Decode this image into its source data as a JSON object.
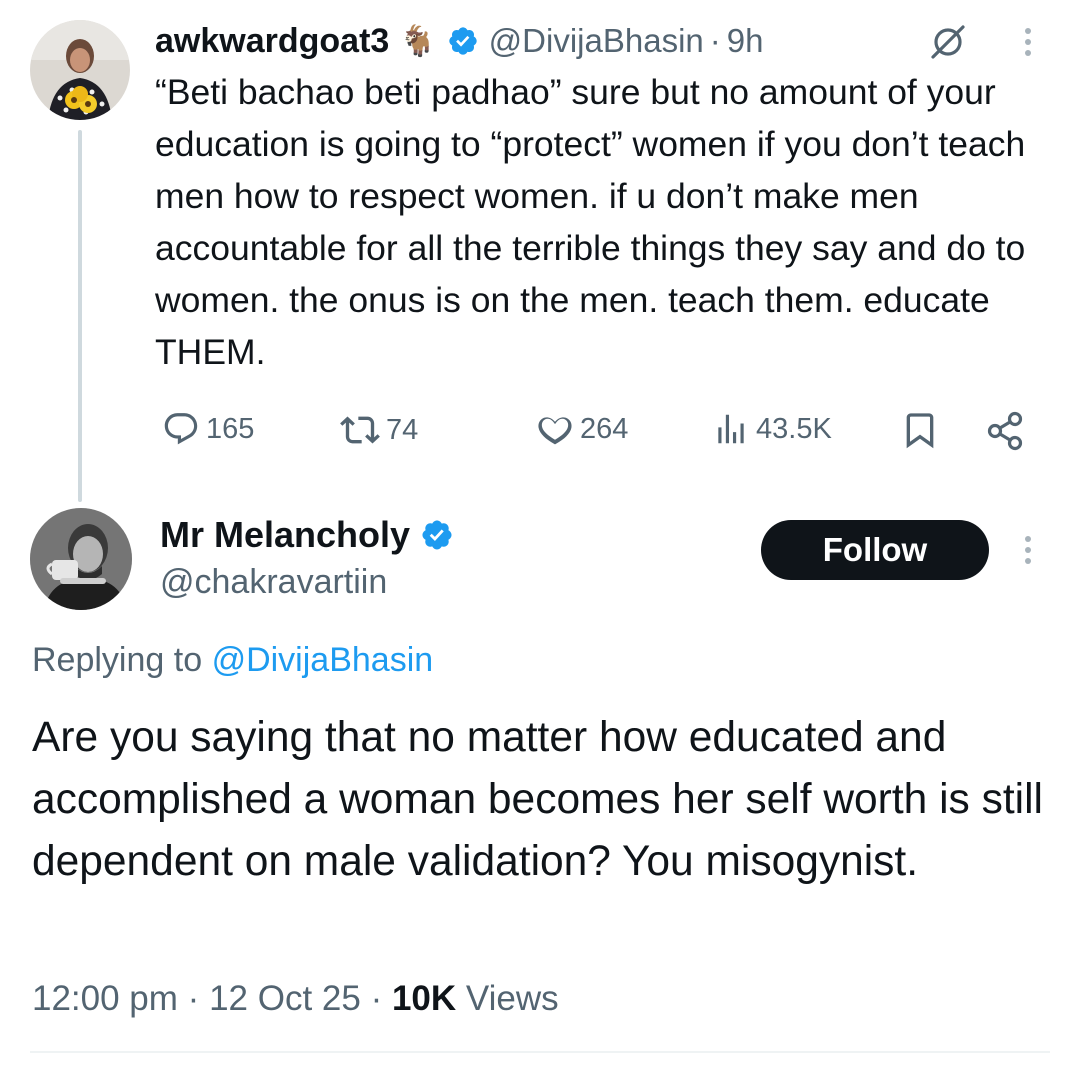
{
  "quoted_tweet": {
    "author_name": "awkwardgoat3",
    "author_emoji": "🐐",
    "handle": "@DivijaBhasin",
    "separator": "·",
    "time": "9h",
    "text": "“Beti bachao beti padhao” sure but no amount of your education is going to “protect” women if you don’t teach men how to respect women. if u don’t make men accountable for all the terrible things they say and do to women. the onus is on the men. teach them. educate THEM.",
    "actions": {
      "replies": "165",
      "retweets": "74",
      "likes": "264",
      "views": "43.5K"
    }
  },
  "main_tweet": {
    "author_name": "Mr Melancholy",
    "handle": "@chakravartiin",
    "follow_label": "Follow",
    "replying_prefix": "Replying to",
    "replying_handle": "@DivijaBhasin",
    "text": "Are you saying that no matter how educated and accomplished a woman becomes her self worth is still dependent on male validation? You misogynist.",
    "time": "12:00 pm",
    "date": "12 Oct 25",
    "separator": "·",
    "views_count": "10K",
    "views_label": "Views"
  },
  "colors": {
    "accent": "#1d9bf0",
    "text": "#0f1419",
    "secondary": "#536471",
    "button_bg": "#0f1419"
  },
  "icons": [
    "verified-badge-icon",
    "grok-icon",
    "more-icon",
    "reply-icon",
    "retweet-icon",
    "like-icon",
    "views-icon",
    "bookmark-icon",
    "share-icon"
  ]
}
